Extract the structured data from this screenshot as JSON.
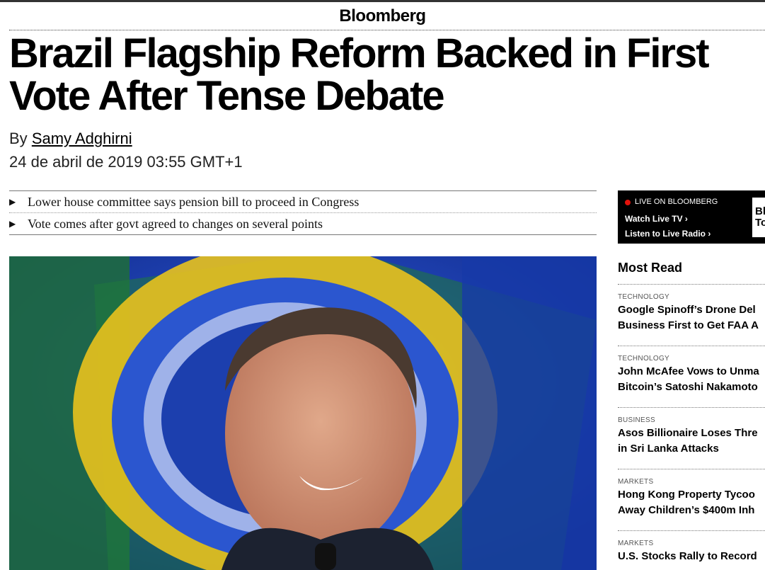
{
  "brand": "Bloomberg",
  "article": {
    "headline": "Brazil Flagship Reform Backed in First Vote After Tense Debate",
    "byline_prefix": "By",
    "author": "Samy Adghirni",
    "date": "24 de abril de 2019 03:55 GMT+1",
    "summary": [
      "Lower house committee says pension bill to proceed in Congress",
      "Vote comes after govt agreed to changes on several points"
    ]
  },
  "live": {
    "label": "LIVE ON BLOOMBERG",
    "watch": "Watch Live TV",
    "listen": "Listen to Live Radio",
    "thumb_text": "Bl\nTo"
  },
  "most_read": {
    "title": "Most Read",
    "items": [
      {
        "category": "TECHNOLOGY",
        "line1": "Google Spinoff’s Drone Del",
        "line2": "Business First to Get FAA A"
      },
      {
        "category": "TECHNOLOGY",
        "line1": "John McAfee Vows to Unma",
        "line2": "Bitcoin’s Satoshi Nakamoto"
      },
      {
        "category": "BUSINESS",
        "line1": "Asos Billionaire Loses Thre",
        "line2": "in Sri Lanka Attacks"
      },
      {
        "category": "MARKETS",
        "line1": "Hong Kong Property Tycoo",
        "line2": "Away Children’s $400m Inh"
      },
      {
        "category": "MARKETS",
        "line1": "U.S. Stocks Rally to Record",
        "line2": ""
      }
    ]
  },
  "colors": {
    "live_dot": "#e3120b",
    "photo_background": "#1a3fb0"
  }
}
